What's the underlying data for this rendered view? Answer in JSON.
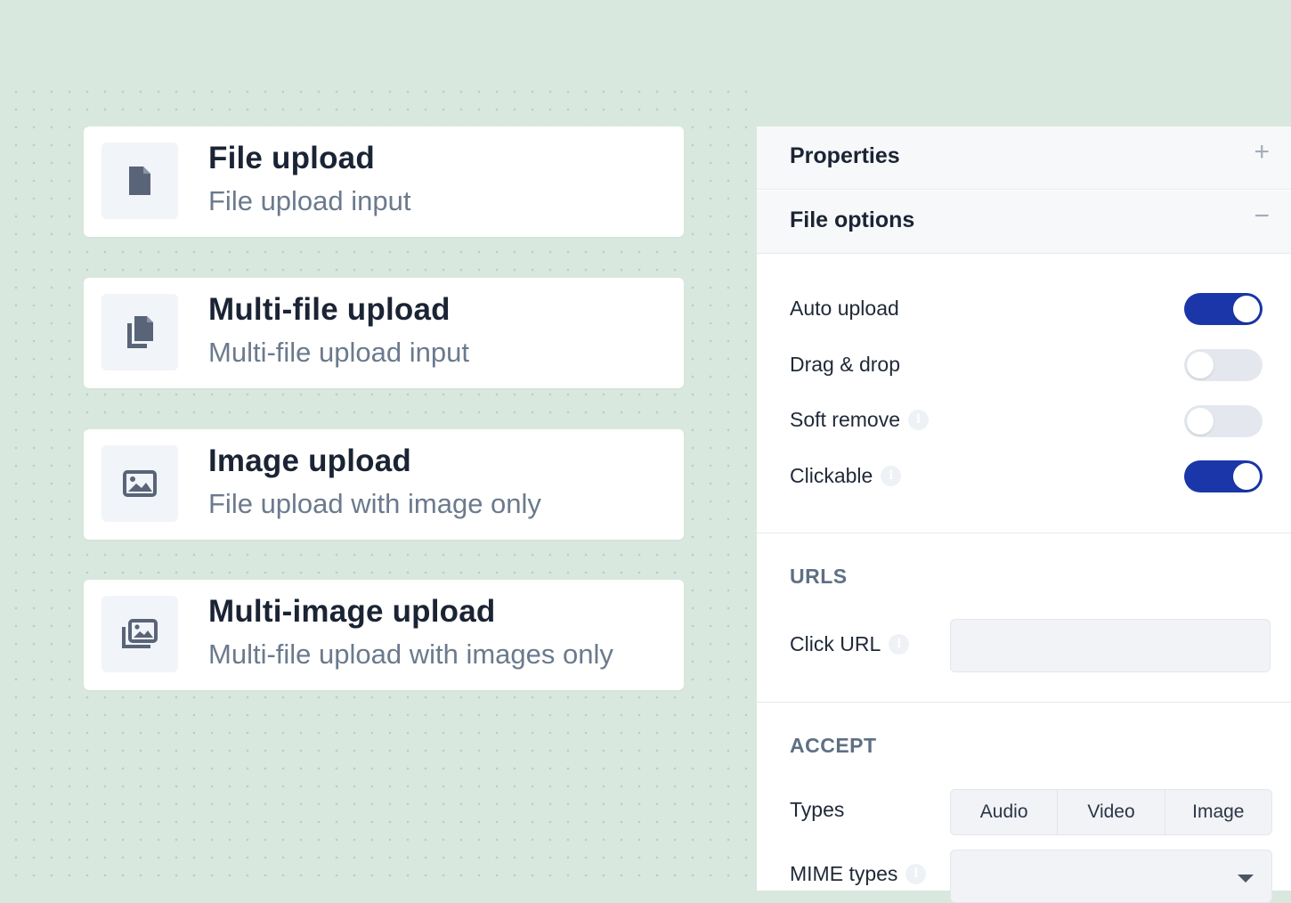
{
  "colors": {
    "canvas_bg": "#d8e8de",
    "toggle_on": "#1a36a8",
    "toggle_off": "#e4e8ee",
    "icon_color": "#5a6478"
  },
  "cards": [
    {
      "icon": "file-icon",
      "title": "File upload",
      "subtitle": "File upload input"
    },
    {
      "icon": "files-icon",
      "title": "Multi-file upload",
      "subtitle": "Multi-file upload input"
    },
    {
      "icon": "image-icon",
      "title": "Image upload",
      "subtitle": "File upload with image only"
    },
    {
      "icon": "images-icon",
      "title": "Multi-image upload",
      "subtitle": "Multi-file upload with images only"
    }
  ],
  "panel": {
    "properties": {
      "label": "Properties",
      "sign": "+"
    },
    "file_options": {
      "label": "File options",
      "sign": "−"
    },
    "options": [
      {
        "label": "Auto upload",
        "on": true,
        "info": false
      },
      {
        "label": "Drag & drop",
        "on": false,
        "info": false
      },
      {
        "label": "Soft remove",
        "on": false,
        "info": true
      },
      {
        "label": "Clickable",
        "on": true,
        "info": true
      }
    ],
    "urls": {
      "title": "URLS",
      "click_url_label": "Click URL",
      "click_url_value": ""
    },
    "accept": {
      "title": "ACCEPT",
      "types_label": "Types",
      "types": [
        "Audio",
        "Video",
        "Image"
      ],
      "mime_label": "MIME types",
      "mime_value": ""
    }
  }
}
